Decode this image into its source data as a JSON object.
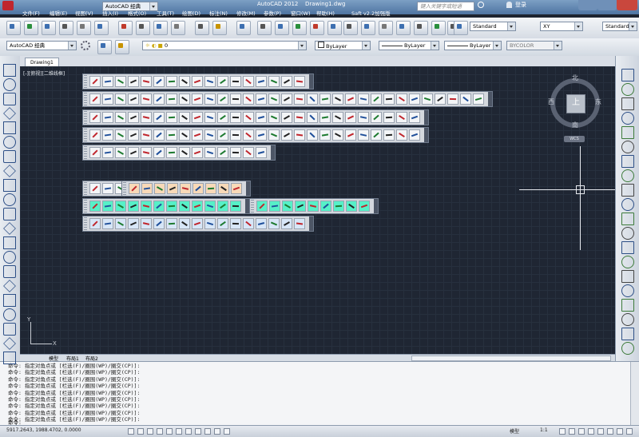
{
  "window": {
    "app_title": "AutoCAD 2012",
    "document_title": "Drawing1.dwg",
    "workspace_title": "AutoCAD 经典",
    "search_placeholder": "键入关键字或短语",
    "login_label": "登录"
  },
  "menus": [
    "文件(F)",
    "编辑(E)",
    "视图(V)",
    "插入(I)",
    "格式(O)",
    "工具(T)",
    "绘图(D)",
    "标注(N)",
    "修改(M)",
    "参数(P)",
    "窗口(W)",
    "帮助(H)",
    "Saft v2.2加强版"
  ],
  "toolbar_styles": {
    "text_style": "Standard",
    "dim_style": "XY",
    "table_style": "Standard"
  },
  "properties_bar": {
    "workspace": "AutoCAD 经典",
    "layer": "0",
    "color": "ByLayer",
    "linetype": "ByLayer",
    "lineweight": "ByLayer",
    "plotstyle": "BYCOLOR"
  },
  "drawing": {
    "tab_label": "Drawing1",
    "viewport_label": "[-][俯视][二维线框]"
  },
  "compass": {
    "north": "北",
    "south": "南",
    "east": "东",
    "west": "西",
    "top": "上",
    "wcs": "WCS"
  },
  "ucs": {
    "y": "Y",
    "x": "X"
  },
  "layout_tabs": [
    "模型",
    "布局1",
    "布局2"
  ],
  "command_history": [
    "命令: 指定对角点或 [栏选(F)/圈围(WP)/圈交(CP)]:",
    "命令: 指定对角点或 [栏选(F)/圈围(WP)/圈交(CP)]:",
    "命令: 指定对角点或 [栏选(F)/圈围(WP)/圈交(CP)]:",
    "命令: 指定对角点或 [栏选(F)/圈围(WP)/圈交(CP)]:",
    "命令: 指定对角点或 [栏选(F)/圈围(WP)/圈交(CP)]:",
    "命令: 指定对角点或 [栏选(F)/圈围(WP)/圈交(CP)]:",
    "命令: 指定对角点或 [栏选(F)/圈围(WP)/圈交(CP)]:",
    "命令: 指定对角点或 [栏选(F)/圈围(WP)/圈交(CP)]:",
    "命令: 指定对角点或 [栏选(F)/圈围(WP)/圈交(CP)]:"
  ],
  "command_prompt": "命令:",
  "status": {
    "coordinates": "5917.2643, 1988.4702, 0.0000",
    "model_label": "模型",
    "scale": "1:1"
  }
}
